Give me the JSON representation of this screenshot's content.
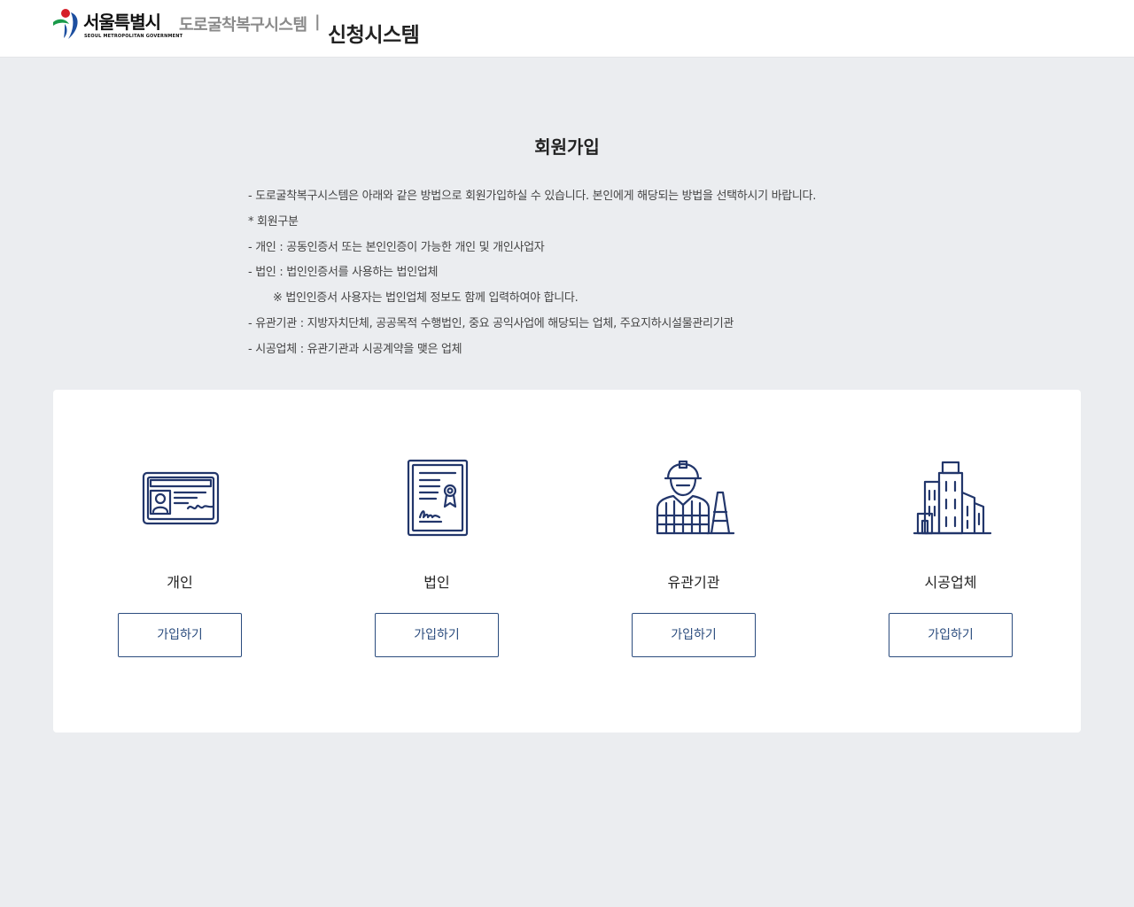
{
  "header": {
    "logo_text": "서울특별시",
    "logo_sub": "SEOUL METROPOLITAN GOVERNMENT",
    "system_name": "도로굴착복구시스템",
    "separator": "|",
    "app_name": "신청시스템"
  },
  "page": {
    "title": "회원가입",
    "info": [
      "- 도로굴착복구시스템은 아래와 같은 방법으로 회원가입하실 수 있습니다. 본인에게 해당되는 방법을 선택하시기 바랍니다.",
      "* 회원구분",
      "- 개인 : 공동인증서 또는 본인인증이 가능한 개인 및 개인사업자",
      "- 법인 : 법인인증서를 사용하는 법인업체",
      "※ 법인인증서 사용자는 법인업체 정보도 함께 입력하여야 합니다.",
      "- 유관기관 : 지방자치단체, 공공목적 수행법인, 중요 공익사업에 해당되는 업체, 주요지하시설물관리기관",
      "- 시공업체 : 유관기관과 시공계약을 맺은 업체"
    ]
  },
  "options": [
    {
      "label": "개인",
      "button": "가입하기",
      "icon": "id-card-icon"
    },
    {
      "label": "법인",
      "button": "가입하기",
      "icon": "certificate-icon"
    },
    {
      "label": "유관기관",
      "button": "가입하기",
      "icon": "construction-worker-icon"
    },
    {
      "label": "시공업체",
      "button": "가입하기",
      "icon": "buildings-icon"
    }
  ],
  "colors": {
    "background": "#ebedf0",
    "icon_navy": "#22366b",
    "button_border": "#2b4c7e",
    "logo_red": "#d6202a",
    "logo_blue": "#1d4fa0",
    "logo_green": "#1a9a4a"
  }
}
